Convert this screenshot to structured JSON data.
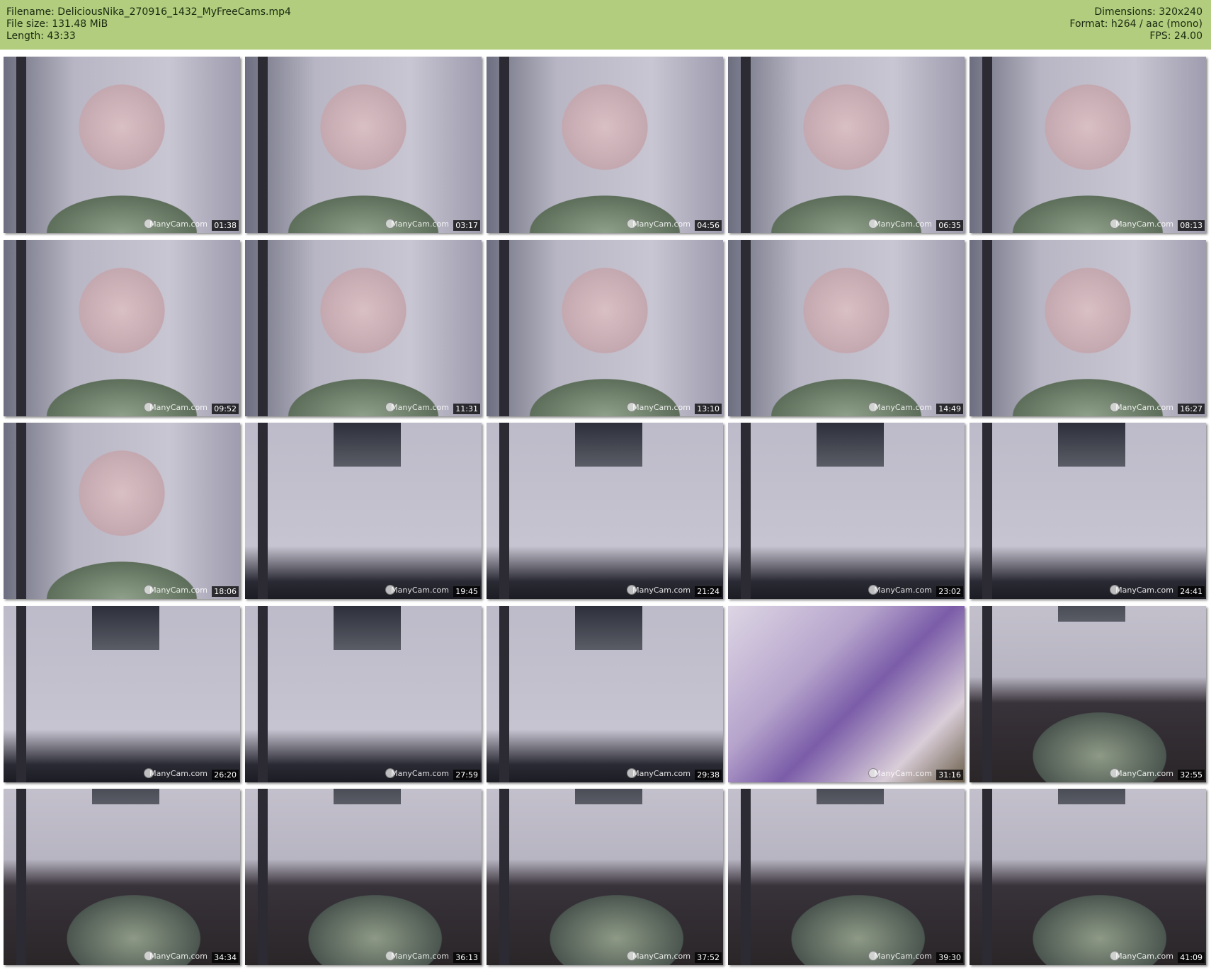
{
  "header": {
    "filename": "Filename: DeliciousNika_270916_1432_MyFreeCams.mp4",
    "filesize": "File size: 131.48 MiB",
    "length": "Length: 43:33",
    "dimensions": "Dimensions: 320x240",
    "format": "Format: h264 / aac (mono)",
    "fps": "FPS: 24.00"
  },
  "watermark": "ManyCam.com",
  "thumbnails": [
    {
      "time": "01:38",
      "scene": "faces"
    },
    {
      "time": "03:17",
      "scene": "faces"
    },
    {
      "time": "04:56",
      "scene": "faces"
    },
    {
      "time": "06:35",
      "scene": "faces"
    },
    {
      "time": "08:13",
      "scene": "faces"
    },
    {
      "time": "09:52",
      "scene": "faces"
    },
    {
      "time": "11:31",
      "scene": "faces"
    },
    {
      "time": "13:10",
      "scene": "faces"
    },
    {
      "time": "14:49",
      "scene": "faces"
    },
    {
      "time": "16:27",
      "scene": "faces"
    },
    {
      "time": "18:06",
      "scene": "faces"
    },
    {
      "time": "19:45",
      "scene": "room"
    },
    {
      "time": "21:24",
      "scene": "room"
    },
    {
      "time": "23:02",
      "scene": "room"
    },
    {
      "time": "24:41",
      "scene": "room"
    },
    {
      "time": "26:20",
      "scene": "room"
    },
    {
      "time": "27:59",
      "scene": "room"
    },
    {
      "time": "29:38",
      "scene": "room"
    },
    {
      "time": "31:16",
      "scene": "blur"
    },
    {
      "time": "32:55",
      "scene": "floor"
    },
    {
      "time": "34:34",
      "scene": "floor"
    },
    {
      "time": "36:13",
      "scene": "floor"
    },
    {
      "time": "37:52",
      "scene": "floor"
    },
    {
      "time": "39:30",
      "scene": "floor"
    },
    {
      "time": "41:09",
      "scene": "floor"
    }
  ]
}
